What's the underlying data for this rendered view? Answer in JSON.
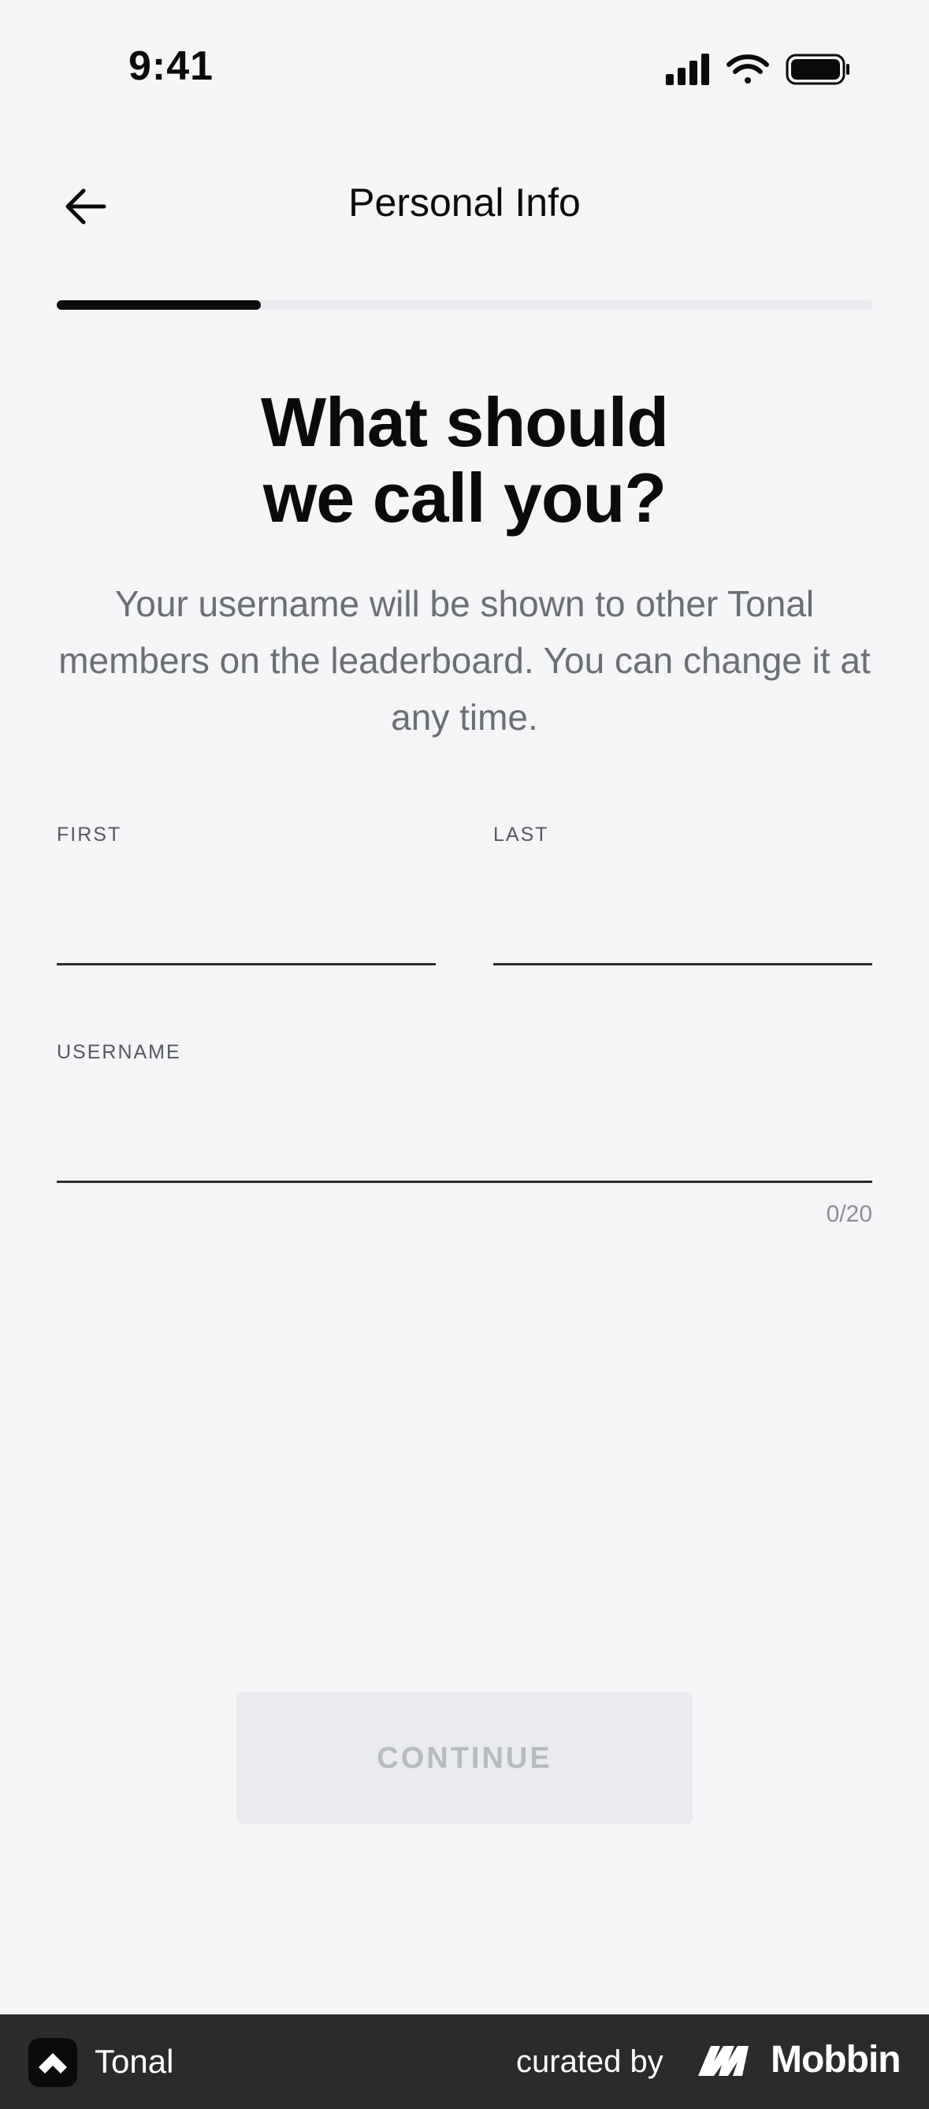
{
  "status_bar": {
    "time": "9:41"
  },
  "header": {
    "title": "Personal Info"
  },
  "progress": {
    "fraction": 0.25
  },
  "heading": {
    "line1": "What should",
    "line2": "we call you?"
  },
  "subtext": "Your username will be shown to other Tonal members on the leaderboard. You can change it at any time.",
  "form": {
    "first": {
      "label": "FIRST",
      "value": ""
    },
    "last": {
      "label": "LAST",
      "value": ""
    },
    "username": {
      "label": "USERNAME",
      "value": "",
      "counter": "0/20"
    }
  },
  "continue": {
    "label": "CONTINUE",
    "enabled": false
  },
  "footer": {
    "app_name": "Tonal",
    "curated_label": "curated by",
    "brand": "Mobbin"
  },
  "colors": {
    "background": "#f4f5f7",
    "text": "#0b0b0b",
    "muted": "#6b6e73",
    "footer": "#2b2b2d",
    "button_disabled": "#e9ebee"
  },
  "icons": {
    "back": "arrow-left-icon",
    "signal": "signal-icon",
    "wifi": "wifi-icon",
    "battery": "battery-icon",
    "app_logo": "tonal-logo-icon",
    "brand_logo": "mobbin-logo-icon"
  }
}
